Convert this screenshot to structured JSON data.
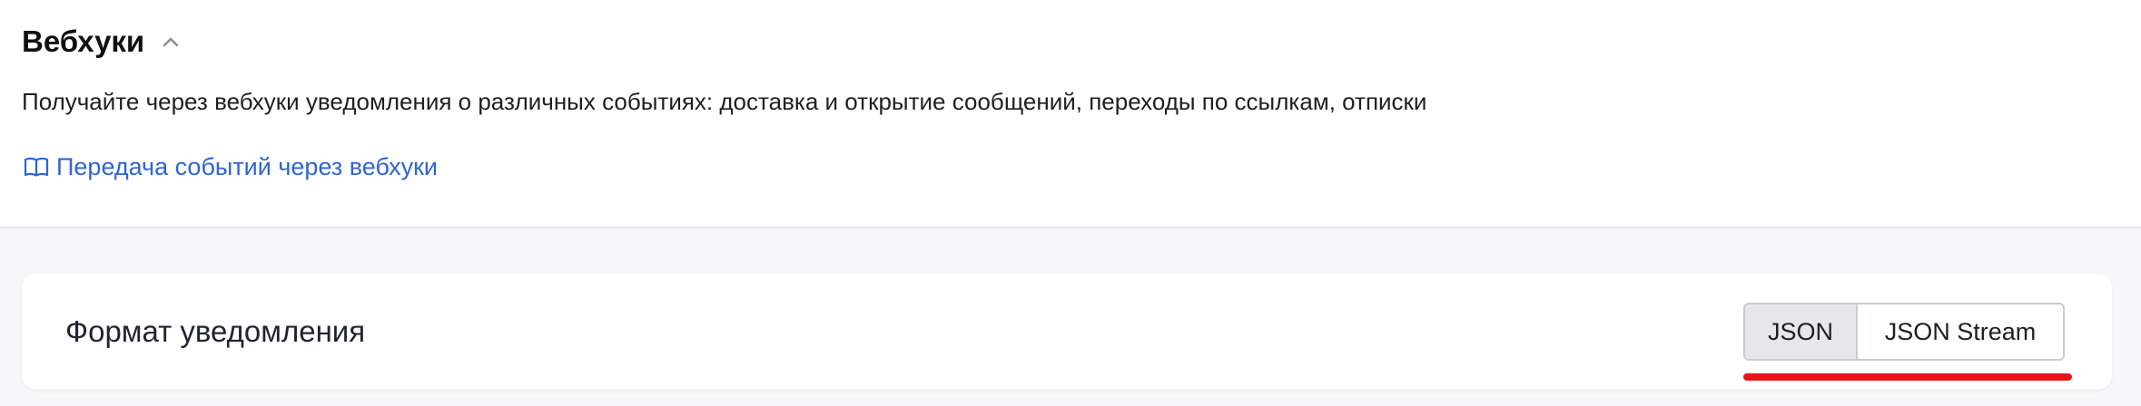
{
  "section": {
    "title": "Вебхуки",
    "description": "Получайте через вебхуки уведомления о различных событиях: доставка и открытие сообщений, переходы по ссылкам, отписки",
    "doc_link_label": "Передача событий через вебхуки"
  },
  "format": {
    "label": "Формат уведомления",
    "options": [
      "JSON",
      "JSON Stream"
    ],
    "selected": "JSON"
  },
  "colors": {
    "link": "#2f64d6",
    "active_segment": "#e5e7eb",
    "annotation": "#e8141c",
    "background_gray": "#f6f7f9"
  },
  "icons": {
    "collapse": "chevron-up-icon",
    "docs": "book-open-icon"
  }
}
